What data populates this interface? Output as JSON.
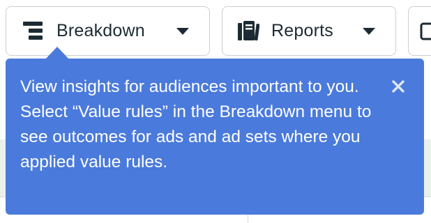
{
  "toolbar": {
    "breakdown": {
      "label": "Breakdown",
      "icon": "breakdown-icon"
    },
    "reports": {
      "label": "Reports",
      "icon": "reports-icon"
    },
    "partial_button": {
      "icon": "columns-icon"
    }
  },
  "tooltip": {
    "message": "View insights for audiences important to you. Select “Value rules” in the Breakdown menu to see outcomes for ads and ad sets where you applied value rules.",
    "close_icon": "close-icon",
    "background_color": "#4a7adb"
  }
}
